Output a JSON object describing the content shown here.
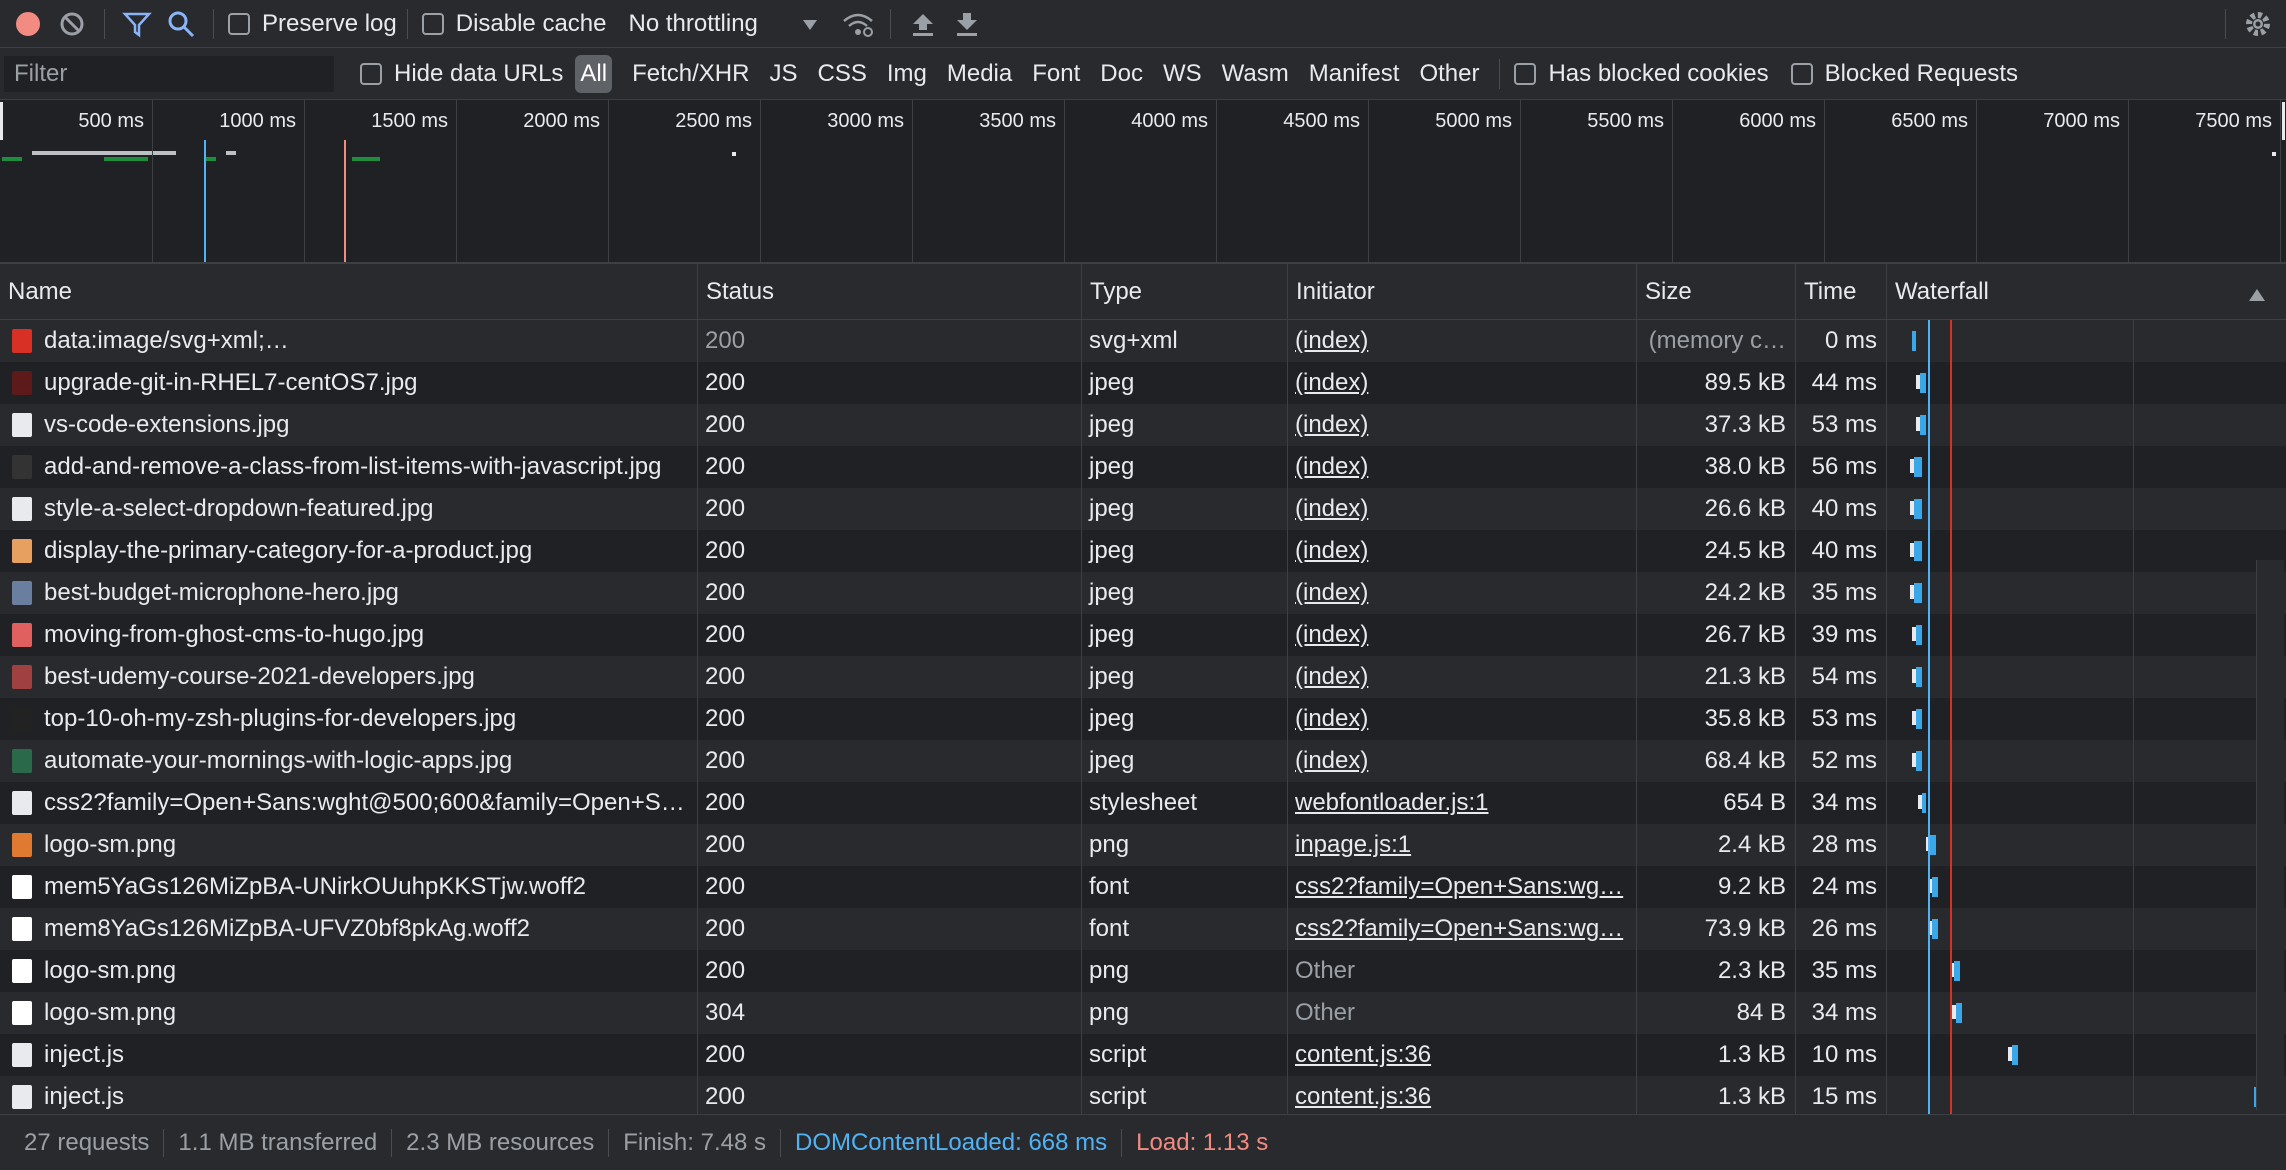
{
  "toolbar": {
    "preserve_log": "Preserve log",
    "disable_cache": "Disable cache",
    "throttling": "No throttling"
  },
  "filterbar": {
    "filter_placeholder": "Filter",
    "hide_data_urls": "Hide data URLs",
    "types": [
      "All",
      "Fetch/XHR",
      "JS",
      "CSS",
      "Img",
      "Media",
      "Font",
      "Doc",
      "WS",
      "Wasm",
      "Manifest",
      "Other"
    ],
    "has_blocked_cookies": "Has blocked cookies",
    "blocked_requests": "Blocked Requests"
  },
  "overview": {
    "ticks": [
      "500 ms",
      "1000 ms",
      "1500 ms",
      "2000 ms",
      "2500 ms",
      "3000 ms",
      "3500 ms",
      "4000 ms",
      "4500 ms",
      "5000 ms",
      "5500 ms",
      "6000 ms",
      "6500 ms",
      "7000 ms",
      "7500 ms"
    ]
  },
  "columns": {
    "name": "Name",
    "status": "Status",
    "type": "Type",
    "initiator": "Initiator",
    "size": "Size",
    "time": "Time",
    "waterfall": "Waterfall"
  },
  "rows": [
    {
      "name": "data:image/svg+xml;…",
      "status": "200",
      "type": "svg+xml",
      "initiator": "(index)",
      "size": "(memory c…",
      "time": "0 ms",
      "icon_color": "#d93025",
      "status_dim": true,
      "initiator_link": true,
      "size_dim": true
    },
    {
      "name": "upgrade-git-in-RHEL7-centOS7.jpg",
      "status": "200",
      "type": "jpeg",
      "initiator": "(index)",
      "size": "89.5 kB",
      "time": "44 ms",
      "icon_color": "#5c1a1a",
      "initiator_link": true
    },
    {
      "name": "vs-code-extensions.jpg",
      "status": "200",
      "type": "jpeg",
      "initiator": "(index)",
      "size": "37.3 kB",
      "time": "53 ms",
      "icon_color": "#e8eaed",
      "initiator_link": true
    },
    {
      "name": "add-and-remove-a-class-from-list-items-with-javascript.jpg",
      "status": "200",
      "type": "jpeg",
      "initiator": "(index)",
      "size": "38.0 kB",
      "time": "56 ms",
      "icon_color": "#333333",
      "initiator_link": true
    },
    {
      "name": "style-a-select-dropdown-featured.jpg",
      "status": "200",
      "type": "jpeg",
      "initiator": "(index)",
      "size": "26.6 kB",
      "time": "40 ms",
      "icon_color": "#e8eaed",
      "initiator_link": true
    },
    {
      "name": "display-the-primary-category-for-a-product.jpg",
      "status": "200",
      "type": "jpeg",
      "initiator": "(index)",
      "size": "24.5 kB",
      "time": "40 ms",
      "icon_color": "#e8a060",
      "initiator_link": true
    },
    {
      "name": "best-budget-microphone-hero.jpg",
      "status": "200",
      "type": "jpeg",
      "initiator": "(index)",
      "size": "24.2 kB",
      "time": "35 ms",
      "icon_color": "#6a7fa0",
      "initiator_link": true
    },
    {
      "name": "moving-from-ghost-cms-to-hugo.jpg",
      "status": "200",
      "type": "jpeg",
      "initiator": "(index)",
      "size": "26.7 kB",
      "time": "39 ms",
      "icon_color": "#e06060",
      "initiator_link": true
    },
    {
      "name": "best-udemy-course-2021-developers.jpg",
      "status": "200",
      "type": "jpeg",
      "initiator": "(index)",
      "size": "21.3 kB",
      "time": "54 ms",
      "icon_color": "#a04040",
      "initiator_link": true
    },
    {
      "name": "top-10-oh-my-zsh-plugins-for-developers.jpg",
      "status": "200",
      "type": "jpeg",
      "initiator": "(index)",
      "size": "35.8 kB",
      "time": "53 ms",
      "icon_color": "#222222",
      "initiator_link": true
    },
    {
      "name": "automate-your-mornings-with-logic-apps.jpg",
      "status": "200",
      "type": "jpeg",
      "initiator": "(index)",
      "size": "68.4 kB",
      "time": "52 ms",
      "icon_color": "#2a6a4a",
      "initiator_link": true
    },
    {
      "name": "css2?family=Open+Sans:wght@500;600&family=Open+S…",
      "status": "200",
      "type": "stylesheet",
      "initiator": "webfontloader.js:1",
      "size": "654 B",
      "time": "34 ms",
      "icon_color": "#e8eaed",
      "initiator_link": true
    },
    {
      "name": "logo-sm.png",
      "status": "200",
      "type": "png",
      "initiator": "inpage.js:1",
      "size": "2.4 kB",
      "time": "28 ms",
      "icon_color": "#e07a30",
      "initiator_link": true
    },
    {
      "name": "mem5YaGs126MiZpBA-UNirkOUuhpKKSTjw.woff2",
      "status": "200",
      "type": "font",
      "initiator": "css2?family=Open+Sans:wg…",
      "size": "9.2 kB",
      "time": "24 ms",
      "icon_color": "#ffffff",
      "initiator_link": true
    },
    {
      "name": "mem8YaGs126MiZpBA-UFVZ0bf8pkAg.woff2",
      "status": "200",
      "type": "font",
      "initiator": "css2?family=Open+Sans:wg…",
      "size": "73.9 kB",
      "time": "26 ms",
      "icon_color": "#ffffff",
      "initiator_link": true
    },
    {
      "name": "logo-sm.png",
      "status": "200",
      "type": "png",
      "initiator": "Other",
      "size": "2.3 kB",
      "time": "35 ms",
      "icon_color": "#ffffff",
      "initiator_link": false
    },
    {
      "name": "logo-sm.png",
      "status": "304",
      "type": "png",
      "initiator": "Other",
      "size": "84 B",
      "time": "34 ms",
      "icon_color": "#ffffff",
      "initiator_link": false
    },
    {
      "name": "inject.js",
      "status": "200",
      "type": "script",
      "initiator": "content.js:36",
      "size": "1.3 kB",
      "time": "10 ms",
      "icon_color": "#e8eaed",
      "initiator_link": true
    },
    {
      "name": "inject.js",
      "status": "200",
      "type": "script",
      "initiator": "content.js:36",
      "size": "1.3 kB",
      "time": "15 ms",
      "icon_color": "#e8eaed",
      "initiator_link": true
    }
  ],
  "statusbar": {
    "requests": "27 requests",
    "transferred": "1.1 MB transferred",
    "resources": "2.3 MB resources",
    "finish": "Finish: 7.48 s",
    "dom_content_loaded": "DOMContentLoaded: 668 ms",
    "load": "Load: 1.13 s"
  },
  "colors": {
    "dcl": "#4fb3f6",
    "load": "#f28b82",
    "bar": "#3aa8e8"
  }
}
